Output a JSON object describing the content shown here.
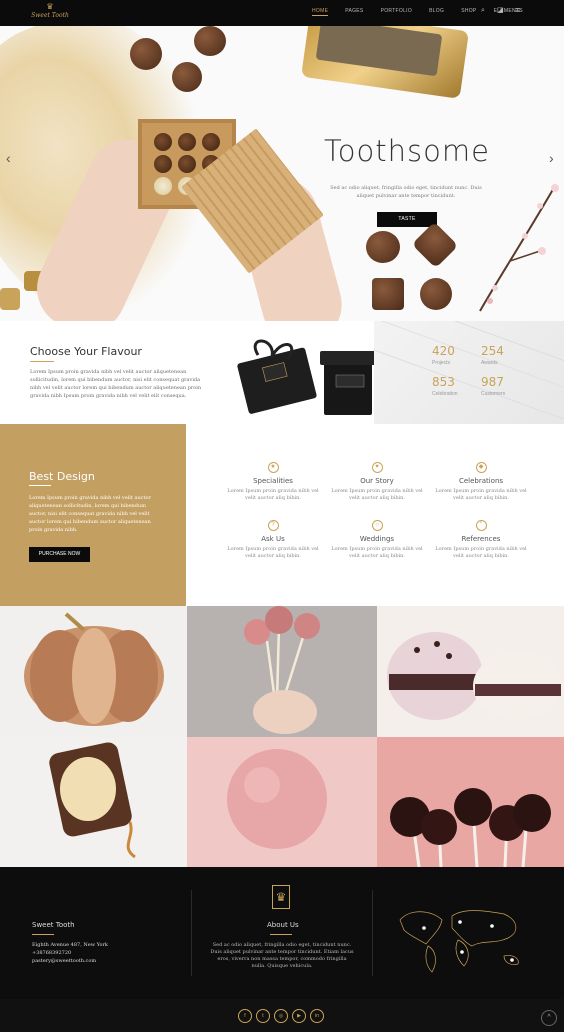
{
  "nav": {
    "logo_text": "Sweet Tooth",
    "menu": [
      {
        "label": "HOME",
        "active": true
      },
      {
        "label": "PAGES",
        "active": false
      },
      {
        "label": "PORTFOLIO",
        "active": false
      },
      {
        "label": "BLOG",
        "active": false
      },
      {
        "label": "SHOP",
        "active": false
      },
      {
        "label": "ELEMENTS",
        "active": false
      }
    ],
    "icons": [
      "search-icon",
      "cart-icon",
      "hamburger-menu-icon"
    ]
  },
  "hero": {
    "title": "Toothsome",
    "text": "Sed ac odio aliquet, fringilla odio eget, tincidunt nunc. Duis aliquet pulvinar ante tempor tincidunt.",
    "button": "TASTE"
  },
  "flavour": {
    "title": "Choose Your Flavour",
    "text": "Lorem Ipsum proin gravida nibh vel velit auctor aliquetenean sollicitudin, lorem qui bibendum auctor, nisi elit consequat gravida nibh vel velit auctor lorem qui bibendum auctor aliquetenean proin gravida nibh Ipsum proin gravida nibh vel velit elit consequa."
  },
  "stats": [
    {
      "value": "420",
      "label": "Projects"
    },
    {
      "value": "254",
      "label": "Awards"
    },
    {
      "value": "853",
      "label": "Celebration"
    },
    {
      "value": "987",
      "label": "Customers"
    }
  ],
  "best": {
    "title": "Best Design",
    "text": "Lorem Ipsum proin gravida nibh vel velit auctor aliquetenean sollicitudin, lorem qui bibendum auctor, nisi elit consequat gravida nibh vel velit auctor lorem qui bibendum auctor aliquetenean proin gravida nibh.",
    "button": "PURCHASE NOW"
  },
  "features": [
    {
      "title": "Specialities",
      "desc": "Lorem Ipsum proin gravida nibh vel velit auctor aliq bibin.",
      "icon": "star-icon"
    },
    {
      "title": "Our Story",
      "desc": "Lorem Ipsum proin gravida nibh vel velit auctor aliq bibin.",
      "icon": "heart-icon"
    },
    {
      "title": "Celebrations",
      "desc": "Lorem Ipsum proin gravida nibh vel velit auctor aliq bibin.",
      "icon": "gift-icon"
    },
    {
      "title": "Ask Us",
      "desc": "Lorem Ipsum proin gravida nibh vel velit auctor aliq bibin.",
      "icon": "question-icon"
    },
    {
      "title": "Weddings",
      "desc": "Lorem Ipsum proin gravida nibh vel velit auctor aliq bibin.",
      "icon": "rings-icon"
    },
    {
      "title": "References",
      "desc": "Lorem Ipsum proin gravida nibh vel velit auctor aliq bibin.",
      "icon": "quote-icon"
    }
  ],
  "gallery": [
    {
      "name": "gallery-pumpkin",
      "bg": "#f2f0ee"
    },
    {
      "name": "gallery-cake-pops",
      "bg": "#c9c4c2"
    },
    {
      "name": "gallery-macarons",
      "bg": "#f4efeb"
    },
    {
      "name": "gallery-toast",
      "bg": "#f3f1ef"
    },
    {
      "name": "gallery-ice-cream",
      "bg": "#f0c9c6"
    },
    {
      "name": "gallery-chocolate-pops",
      "bg": "#e8a7a3"
    }
  ],
  "footer": {
    "brand": "Sweet Tooth",
    "address": "Eighth Avenue 487, New York",
    "phone": "+38768392720",
    "email": "pastery@sweettooth.com",
    "about_title": "About Us",
    "about_text": "Sed ac odio aliquet, fringilla odio eget, tincidunt nunc. Duis aliquet pulvinar ante tempor tincidunt. Etiam lacus eros, viverra non massa tempor, commodo fringilla nulla. Quisque vehicula."
  },
  "social": [
    {
      "label": "f",
      "icon": "facebook-icon"
    },
    {
      "label": "t",
      "icon": "twitter-icon"
    },
    {
      "label": "◎",
      "icon": "instagram-icon"
    },
    {
      "label": "▶",
      "icon": "youtube-icon"
    },
    {
      "label": "in",
      "icon": "linkedin-icon"
    }
  ],
  "colors": {
    "accent": "#c9a35a",
    "dark": "#0b0b0b",
    "gold_panel": "#c3a062"
  }
}
